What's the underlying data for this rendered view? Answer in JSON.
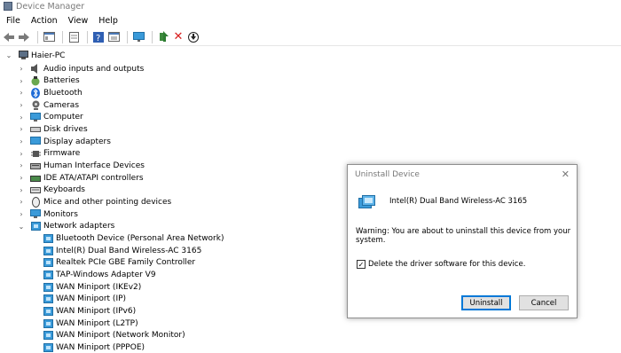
{
  "window": {
    "title": "Device Manager"
  },
  "menu": [
    "File",
    "Action",
    "View",
    "Help"
  ],
  "toolbar": {
    "icons": [
      "back-arrow-icon",
      "forward-arrow-icon",
      "show-hide-console-icon",
      "properties-icon",
      "help-icon",
      "view-icon",
      "monitor-icon",
      "update-driver-icon",
      "uninstall-x-icon",
      "download-icon"
    ],
    "uninstall_color": "#d81e1e"
  },
  "tree": {
    "root": "Haier-PC",
    "categories": [
      {
        "label": "Audio inputs and outputs",
        "icon": "speaker-icon"
      },
      {
        "label": "Batteries",
        "icon": "battery-icon"
      },
      {
        "label": "Bluetooth",
        "icon": "bluetooth-icon"
      },
      {
        "label": "Cameras",
        "icon": "camera-icon"
      },
      {
        "label": "Computer",
        "icon": "computer-icon"
      },
      {
        "label": "Disk drives",
        "icon": "disk-drive-icon"
      },
      {
        "label": "Display adapters",
        "icon": "display-adapter-icon"
      },
      {
        "label": "Firmware",
        "icon": "firmware-icon"
      },
      {
        "label": "Human Interface Devices",
        "icon": "hid-icon"
      },
      {
        "label": "IDE ATA/ATAPI controllers",
        "icon": "ide-controller-icon"
      },
      {
        "label": "Keyboards",
        "icon": "keyboard-icon"
      },
      {
        "label": "Mice and other pointing devices",
        "icon": "mouse-icon"
      },
      {
        "label": "Monitors",
        "icon": "monitor-icon"
      },
      {
        "label": "Network adapters",
        "icon": "network-adapter-icon",
        "expanded": true
      }
    ],
    "network_adapters": [
      "Bluetooth Device (Personal Area Network)",
      "Intel(R) Dual Band Wireless-AC 3165",
      "Realtek PCIe GBE Family Controller",
      "TAP-Windows Adapter V9",
      "WAN Miniport (IKEv2)",
      "WAN Miniport (IP)",
      "WAN Miniport (IPv6)",
      "WAN Miniport (L2TP)",
      "WAN Miniport (Network Monitor)",
      "WAN Miniport (PPPOE)"
    ]
  },
  "dialog": {
    "title": "Uninstall Device",
    "close": "✕",
    "device_name": "Intel(R) Dual Band Wireless-AC 3165",
    "warning": "Warning: You are about to uninstall this device from your system.",
    "checkbox_label": "Delete the driver software for this device.",
    "checkbox_checked": true,
    "checkbox_mark": "✓",
    "uninstall_label": "Uninstall",
    "cancel_label": "Cancel"
  }
}
